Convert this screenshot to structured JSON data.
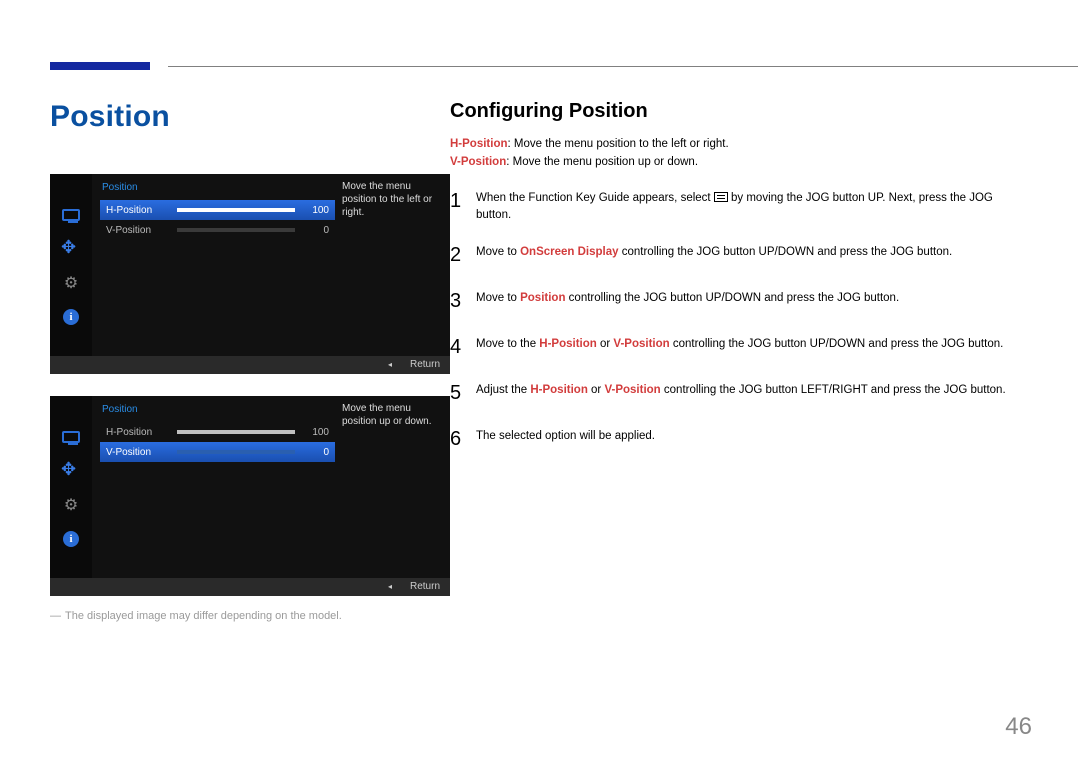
{
  "page_number": "46",
  "section_title": "Position",
  "sub_title": "Configuring Position",
  "definitions": {
    "h_label": "H-Position",
    "h_text": ": Move the menu position to the left or right.",
    "v_label": "V-Position",
    "v_text": ": Move the menu position up or down."
  },
  "steps": [
    {
      "num": "1",
      "parts": [
        "When the Function Key Guide appears, select ",
        {
          "icon": "menu"
        },
        " by moving the JOG button UP. Next, press the JOG button."
      ]
    },
    {
      "num": "2",
      "parts": [
        "Move to ",
        {
          "hl": "OnScreen Display"
        },
        " controlling the JOG button UP/DOWN and press the JOG button."
      ]
    },
    {
      "num": "3",
      "parts": [
        "Move to ",
        {
          "hl": "Position"
        },
        " controlling the JOG button UP/DOWN and press the JOG button."
      ]
    },
    {
      "num": "4",
      "parts": [
        "Move to the ",
        {
          "hl": "H-Position"
        },
        " or ",
        {
          "hl": "V-Position"
        },
        " controlling the JOG button UP/DOWN and press the JOG button."
      ]
    },
    {
      "num": "5",
      "parts": [
        "Adjust the ",
        {
          "hl": "H-Position"
        },
        " or ",
        {
          "hl": "V-Position"
        },
        " controlling the JOG button LEFT/RIGHT and press the JOG button."
      ]
    },
    {
      "num": "6",
      "parts": [
        "The selected option will be applied."
      ]
    }
  ],
  "footnote": "The displayed image may differ depending on the model.",
  "osd1": {
    "title": "Position",
    "desc": "Move the menu position to the left or right.",
    "rows": [
      {
        "label": "H-Position",
        "value": "100",
        "selected": true,
        "fill": 100
      },
      {
        "label": "V-Position",
        "value": "0",
        "selected": false,
        "fill": 0
      }
    ],
    "return": "Return"
  },
  "osd2": {
    "title": "Position",
    "desc": "Move the menu position up or down.",
    "rows": [
      {
        "label": "H-Position",
        "value": "100",
        "selected": false,
        "fill": 100
      },
      {
        "label": "V-Position",
        "value": "0",
        "selected": true,
        "fill": 0
      }
    ],
    "return": "Return"
  }
}
